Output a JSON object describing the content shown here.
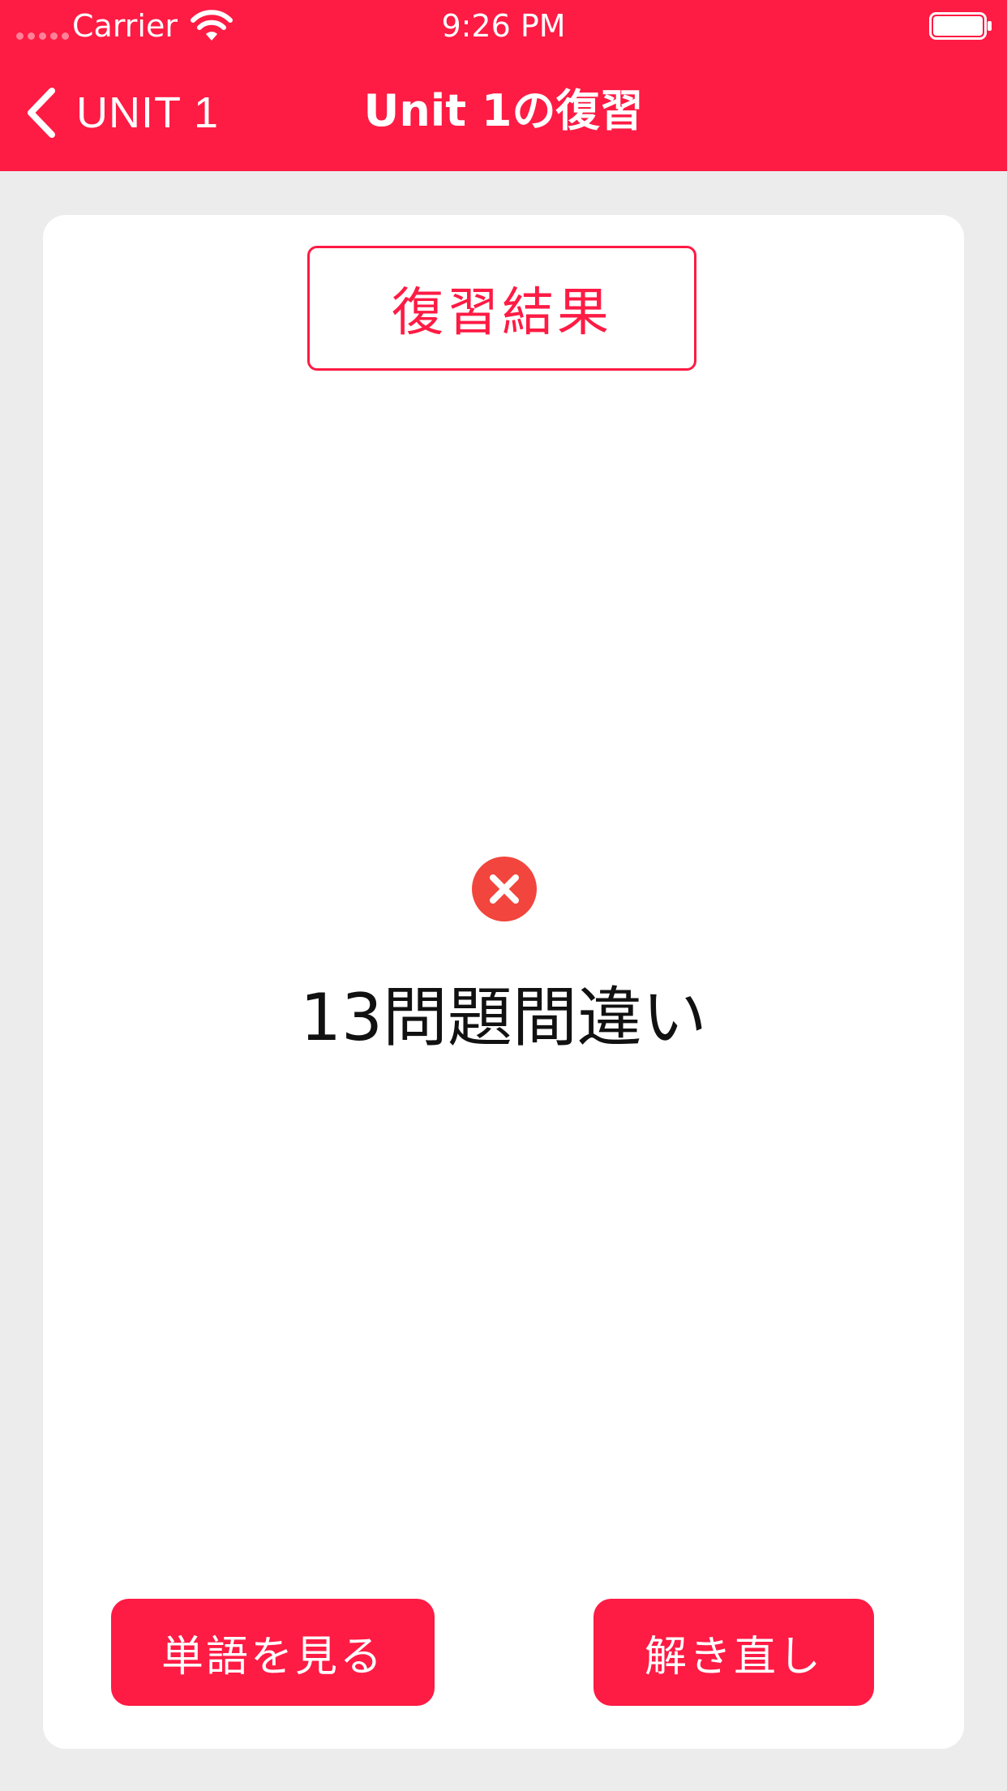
{
  "status_bar": {
    "carrier": "Carrier",
    "time": "9:26 PM",
    "wifi_icon": "wifi-icon",
    "battery_icon": "battery-icon"
  },
  "nav": {
    "back_label": "UNIT 1",
    "title": "Unit 1の復習",
    "back_icon": "chevron-left-icon"
  },
  "result": {
    "heading": "復習結果",
    "status_icon": "error-x-icon",
    "message": "13問題間違い"
  },
  "actions": {
    "view_words": "単語を見る",
    "retry": "解き直し"
  },
  "colors": {
    "accent": "#fe1b44",
    "error_icon": "#f2453d",
    "background": "#ececec",
    "card": "#ffffff"
  }
}
